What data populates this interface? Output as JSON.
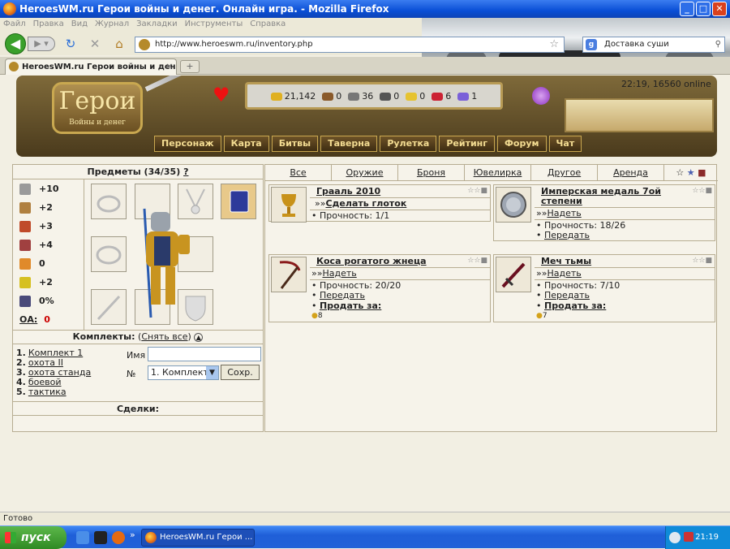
{
  "window": {
    "title": "HeroesWM.ru Герои войны и денег. Онлайн игра. - Mozilla Firefox",
    "buttons": [
      "_",
      "□",
      "✕"
    ]
  },
  "menu": [
    "Файл",
    "Правка",
    "Вид",
    "Журнал",
    "Закладки",
    "Инструменты",
    "Справка"
  ],
  "nav": {
    "url": "http://www.heroeswm.ru/inventory.php",
    "search_value": "Доставка суши"
  },
  "tab": {
    "title": "HeroesWM.ru Герои войны и денег. ...",
    "new": "+"
  },
  "game": {
    "logo": "Герои",
    "logo_sub": "Войны и денег",
    "clock": "22:19, 16560 online",
    "resources": [
      {
        "icon": "gold-icon",
        "value": "21,142",
        "color": "#e0b020"
      },
      {
        "icon": "wood-icon",
        "value": "0",
        "color": "#8a5a2a"
      },
      {
        "icon": "ore-icon",
        "value": "36",
        "color": "#777777"
      },
      {
        "icon": "mercury-icon",
        "value": "0",
        "color": "#555555"
      },
      {
        "icon": "sulfur-icon",
        "value": "0",
        "color": "#e6c330"
      },
      {
        "icon": "crystal-icon",
        "value": "6",
        "color": "#cc2233"
      },
      {
        "icon": "gems-icon",
        "value": "1",
        "color": "#7a60d8"
      }
    ],
    "menu": [
      "Персонаж",
      "Карта",
      "Битвы",
      "Таверна",
      "Рулетка",
      "Рейтинг",
      "Форум",
      "Чат"
    ]
  },
  "inventory": {
    "title": "Предметы (34/35)",
    "help": "?",
    "stats": [
      {
        "icon": "attack-icon",
        "value": "+10",
        "color": "#9a9a9a"
      },
      {
        "icon": "defense-icon",
        "value": "+2",
        "color": "#b08040"
      },
      {
        "icon": "magic-icon",
        "value": "+3",
        "color": "#c04a2a"
      },
      {
        "icon": "knowledge-icon",
        "value": "+4",
        "color": "#a04040"
      },
      {
        "icon": "luck-icon",
        "value": "0",
        "color": "#e08a2a"
      },
      {
        "icon": "morale-icon",
        "value": "+2",
        "color": "#d6c020"
      },
      {
        "icon": "fatigue-icon",
        "value": "0%",
        "color": "#4a4a7a"
      },
      {
        "icon": "oa-icon",
        "label": "ОА:",
        "value": "0"
      }
    ],
    "sets_title": "Комплекты:",
    "sets_remove": "Снять все",
    "sets": [
      {
        "n": "1.",
        "name": "Комплект 1"
      },
      {
        "n": "2.",
        "name": "охота II"
      },
      {
        "n": "3.",
        "name": "охота станда"
      },
      {
        "n": "4.",
        "name": "боевой"
      },
      {
        "n": "5.",
        "name": "тактика"
      }
    ],
    "name_label": "Имя",
    "num_label": "№",
    "num_value": "1. Комплект",
    "save": "Сохр.",
    "deals": "Сделки:"
  },
  "shop": {
    "tabs": [
      "Все",
      "Оружие",
      "Броня",
      "Ювелирка",
      "Другое",
      "Аренда"
    ],
    "items": [
      {
        "name": "Грааль 2010",
        "action": "Сделать глоток",
        "lines": [
          "Прочность: 1/1"
        ]
      },
      {
        "name": "Имперская медаль 7ой степени",
        "action": "Надеть",
        "lines": [
          "Прочность: 18/26",
          "Передать"
        ]
      },
      {
        "name": "Коса рогатого жнеца",
        "action": "Надеть",
        "lines": [
          "Прочность: 20/20",
          "Передать",
          "Продать за:"
        ],
        "price": "8"
      },
      {
        "name": "Меч тьмы",
        "action": "Надеть",
        "lines": [
          "Прочность: 7/10",
          "Передать",
          "Продать за:"
        ],
        "price": "7"
      }
    ],
    "action_prefix": "»»"
  },
  "status": "Готово",
  "taskbar": {
    "start": "пуск",
    "task": "HeroesWM.ru Герои ...",
    "clock": "21:19"
  }
}
